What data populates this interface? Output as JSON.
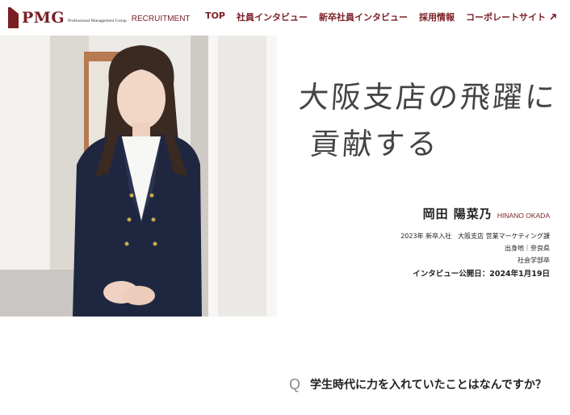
{
  "header": {
    "logo_text": "PMG",
    "logo_sub": "Professional Management Group",
    "logo_recruit": "RECRUITMENT",
    "nav": [
      {
        "label": "TOP"
      },
      {
        "label": "社員インタビュー"
      },
      {
        "label": "新卒社員インタビュー"
      },
      {
        "label": "採用情報"
      },
      {
        "label": "コーポレートサイト",
        "icon": "external-link-icon"
      }
    ]
  },
  "hero": {
    "title_line1": "大阪支店の飛躍に",
    "title_line2": "貢献する"
  },
  "profile": {
    "name": "岡田 陽菜乃",
    "romaji": "HINANO OKADA",
    "details": [
      "2023年 新卒入社　大阪支店 営業マーケティング課",
      "出身地｜奈良県",
      "社会学部卒"
    ],
    "published": "インタビュー公開日：2024年1月19日"
  },
  "interview": {
    "q_mark": "Q",
    "question": "学生時代に力を入れていたことはなんですか？"
  },
  "colors": {
    "brand": "#7a1e24",
    "text": "#222222"
  }
}
